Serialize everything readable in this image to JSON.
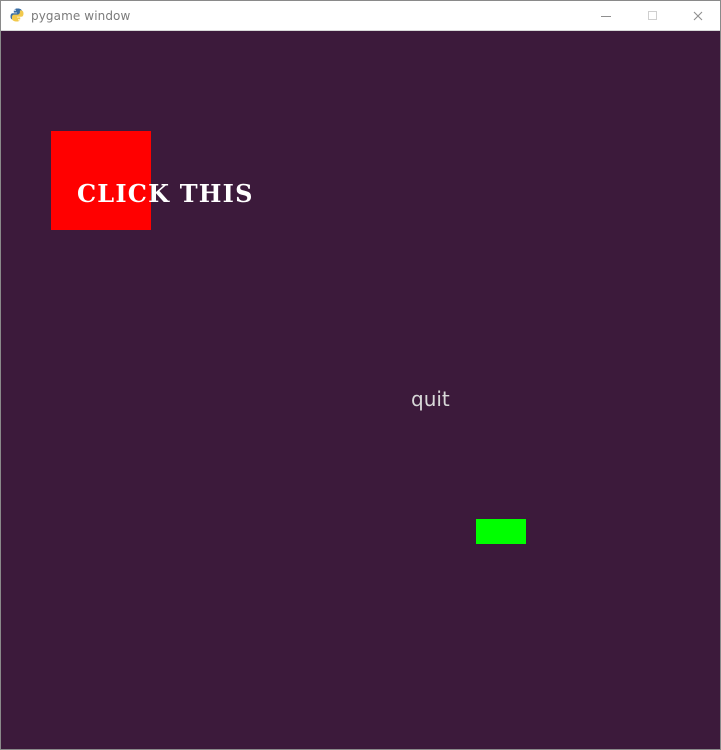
{
  "window": {
    "title": "pygame window"
  },
  "titlebar_icons": {
    "app": "pygame-snake-icon",
    "minimize": "minimize-icon",
    "maximize": "maximize-icon",
    "close": "close-icon"
  },
  "game": {
    "click_label": "CLICK THIS",
    "quit_label": "quit"
  },
  "colors": {
    "background": "#3c1a3b",
    "red_box": "#ff0000",
    "green_box": "#00ff00",
    "click_text": "#ffffff",
    "quit_text": "#d8d8d8"
  }
}
